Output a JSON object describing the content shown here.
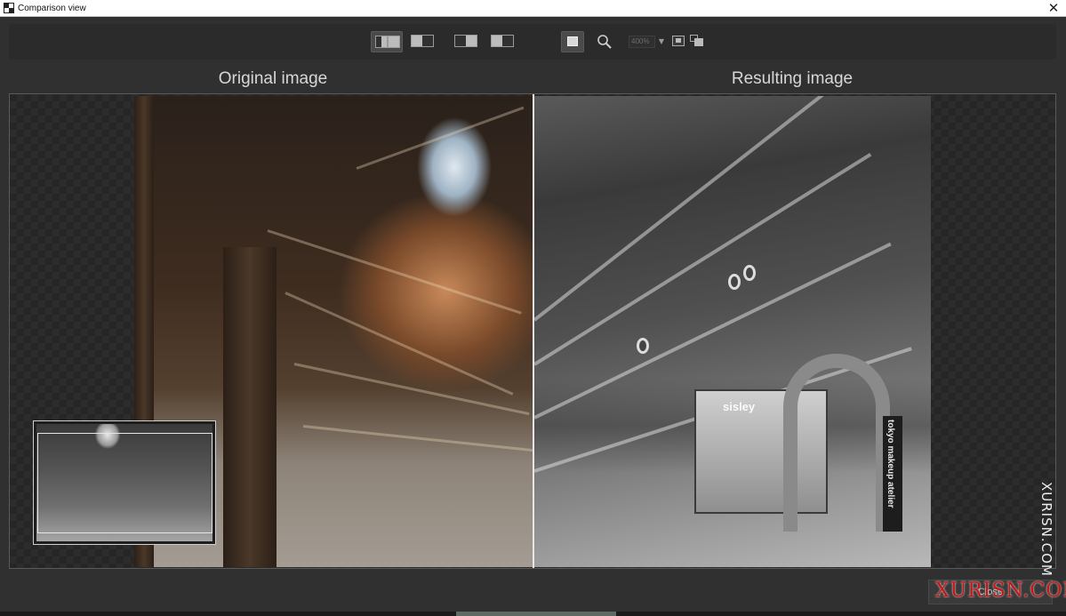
{
  "window": {
    "title": "Comparison view",
    "close_glyph": "✕"
  },
  "toolbar": {
    "buttons": [
      {
        "name": "split-vertical",
        "icon": "split-view-icon",
        "active": true
      },
      {
        "name": "split-horizontal",
        "icon": "split-view-icon",
        "active": false
      },
      {
        "name": "side-by-side-left",
        "icon": "split-view-icon",
        "active": false
      },
      {
        "name": "side-by-side-right",
        "icon": "split-view-icon",
        "active": false
      },
      {
        "name": "single-view",
        "icon": "single-view-icon",
        "active": true
      }
    ],
    "zoom_value": "400%",
    "zoom_dropdown_glyph": "▼"
  },
  "panes": {
    "original_title": "Original image",
    "result_title": "Resulting image"
  },
  "result_image": {
    "shop_sign": "sisley",
    "vertical_sign": "tokyo makeup atelier"
  },
  "watermarks": {
    "vertical": "XURISN.COM",
    "bottom": "XURISN.COM"
  },
  "footer": {
    "button_label": "Close"
  },
  "colors": {
    "background": "#303030",
    "divider": "#e6e6e6",
    "title_text": "#d7d7d7",
    "watermark_red": "#c81414"
  }
}
